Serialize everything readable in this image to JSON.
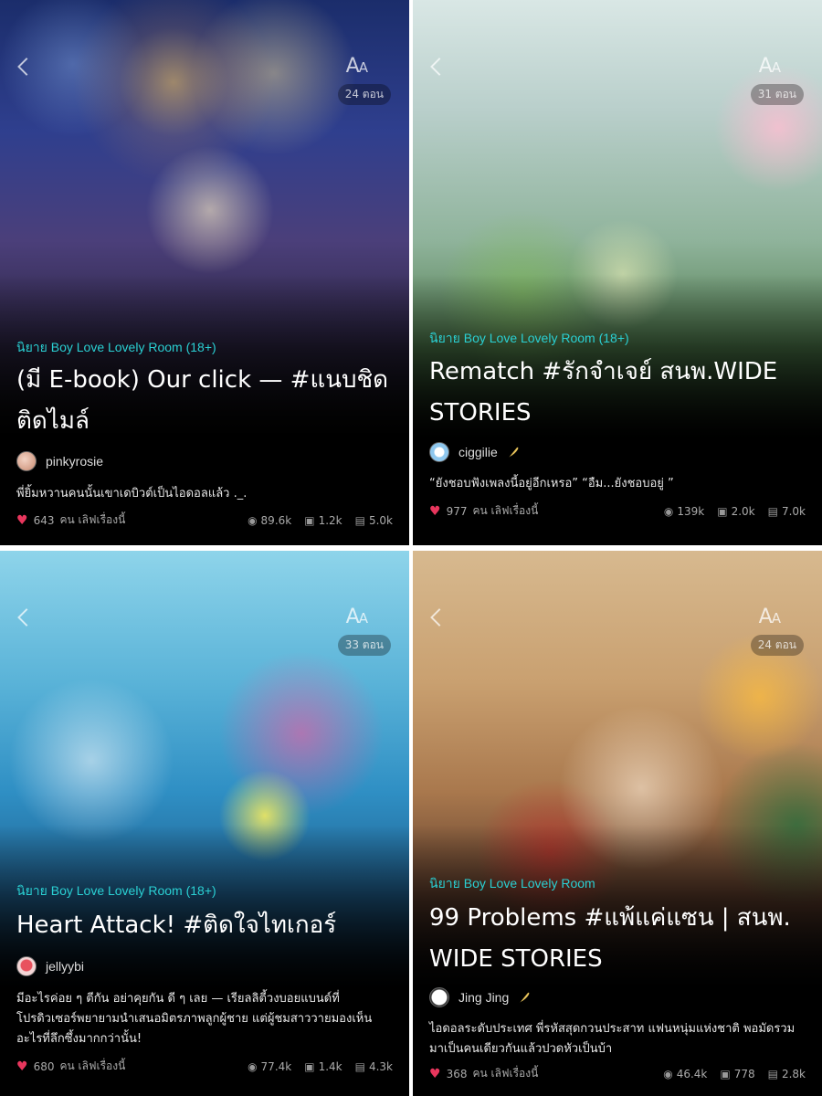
{
  "colors": {
    "genre": "#2ad0d3",
    "heart": "#e8365d",
    "background": "#000000"
  },
  "stories": [
    {
      "episodes": "24 ตอน",
      "genre": "นิยาย Boy Love Lovely Room (18+)",
      "title": "(มี E-book) Our click — #แนบชิดติดไมล์",
      "author": "pinkyrosie",
      "author_feather": false,
      "synopsis": "พี่ยิ้มหวานคนนั้นเขาเดบิวต์เป็นไอดอลแล้ว ._.",
      "likes": "643",
      "likes_label": "คน เลิฟเรื่องนี้",
      "views": "89.6k",
      "comments": "1.2k",
      "chapters": "5.0k"
    },
    {
      "episodes": "31 ตอน",
      "genre": "นิยาย Boy Love Lovely Room (18+)",
      "title": "Rematch #รักจำเจย์ สนพ.WIDE STORIES",
      "author": "ciggilie",
      "author_feather": true,
      "synopsis": "“ยังชอบฟังเพลงนี้อยู่อีกเหรอ” “อืม...ยังชอบอยู่ ”",
      "likes": "977",
      "likes_label": "คน เลิฟเรื่องนี้",
      "views": "139k",
      "comments": "2.0k",
      "chapters": "7.0k"
    },
    {
      "episodes": "33 ตอน",
      "genre": "นิยาย Boy Love Lovely Room (18+)",
      "title": "Heart Attack! #ติดใจไทเกอร์",
      "author": "jellyybi",
      "author_feather": false,
      "synopsis": "มีอะไรค่อย ๆ ตีกัน อย่าคุยกัน ดี ๆ เลย — เรียลลิตี้วงบอยแบนด์ที่โปรดิวเซอร์พยายามนำเสนอมิตรภาพลูกผู้ชาย แต่ผู้ชมสาววายมองเห็นอะไรที่ลึกซึ้งมากกว่านั้น!",
      "likes": "680",
      "likes_label": "คน เลิฟเรื่องนี้",
      "views": "77.4k",
      "comments": "1.4k",
      "chapters": "4.3k"
    },
    {
      "episodes": "24 ตอน",
      "genre": "นิยาย Boy Love Lovely Room",
      "title": "99 Problems #แพ้แค่แซน | สนพ. WIDE STORIES",
      "author": "Jing Jing",
      "author_feather": true,
      "synopsis": "ไอดอลระดับประเทศ พี่รหัสสุดกวนประสาท แฟนหนุ่มแห่งชาติ พอมัดรวมมาเป็นคนเดียวกันแล้วปวดหัวเป็นบ้า",
      "likes": "368",
      "likes_label": "คน เลิฟเรื่องนี้",
      "views": "46.4k",
      "comments": "778",
      "chapters": "2.8k"
    }
  ]
}
